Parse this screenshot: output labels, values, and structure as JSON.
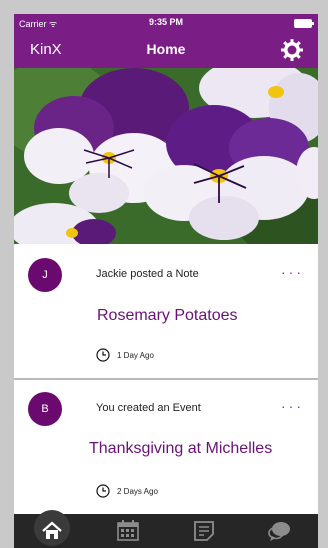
{
  "status_bar": {
    "carrier": "Carrier ᯤ",
    "time": "9:35 PM"
  },
  "navbar": {
    "brand": "KinX",
    "title": "Home",
    "settings_icon": "gear-icon"
  },
  "hero": {
    "subject": "purple-and-white-pansies"
  },
  "feed": [
    {
      "avatar": "J",
      "headline": "Jackie posted a Note",
      "more": "···",
      "title": "Rosemary Potatoes",
      "timestamp": "1 Day Ago"
    },
    {
      "avatar": "B",
      "headline": "You created an Event",
      "more": "···",
      "title": "Thanksgiving at Michelles",
      "timestamp": "2 Days Ago"
    }
  ],
  "tabbar": {
    "items": [
      {
        "icon": "home-icon",
        "active": true
      },
      {
        "icon": "calendar-icon",
        "active": false
      },
      {
        "icon": "notes-icon",
        "active": false
      },
      {
        "icon": "chat-icon",
        "active": false
      }
    ]
  },
  "colors": {
    "brand": "#7a1d84",
    "accent": "#6a1178",
    "tabbar": "#262626"
  }
}
